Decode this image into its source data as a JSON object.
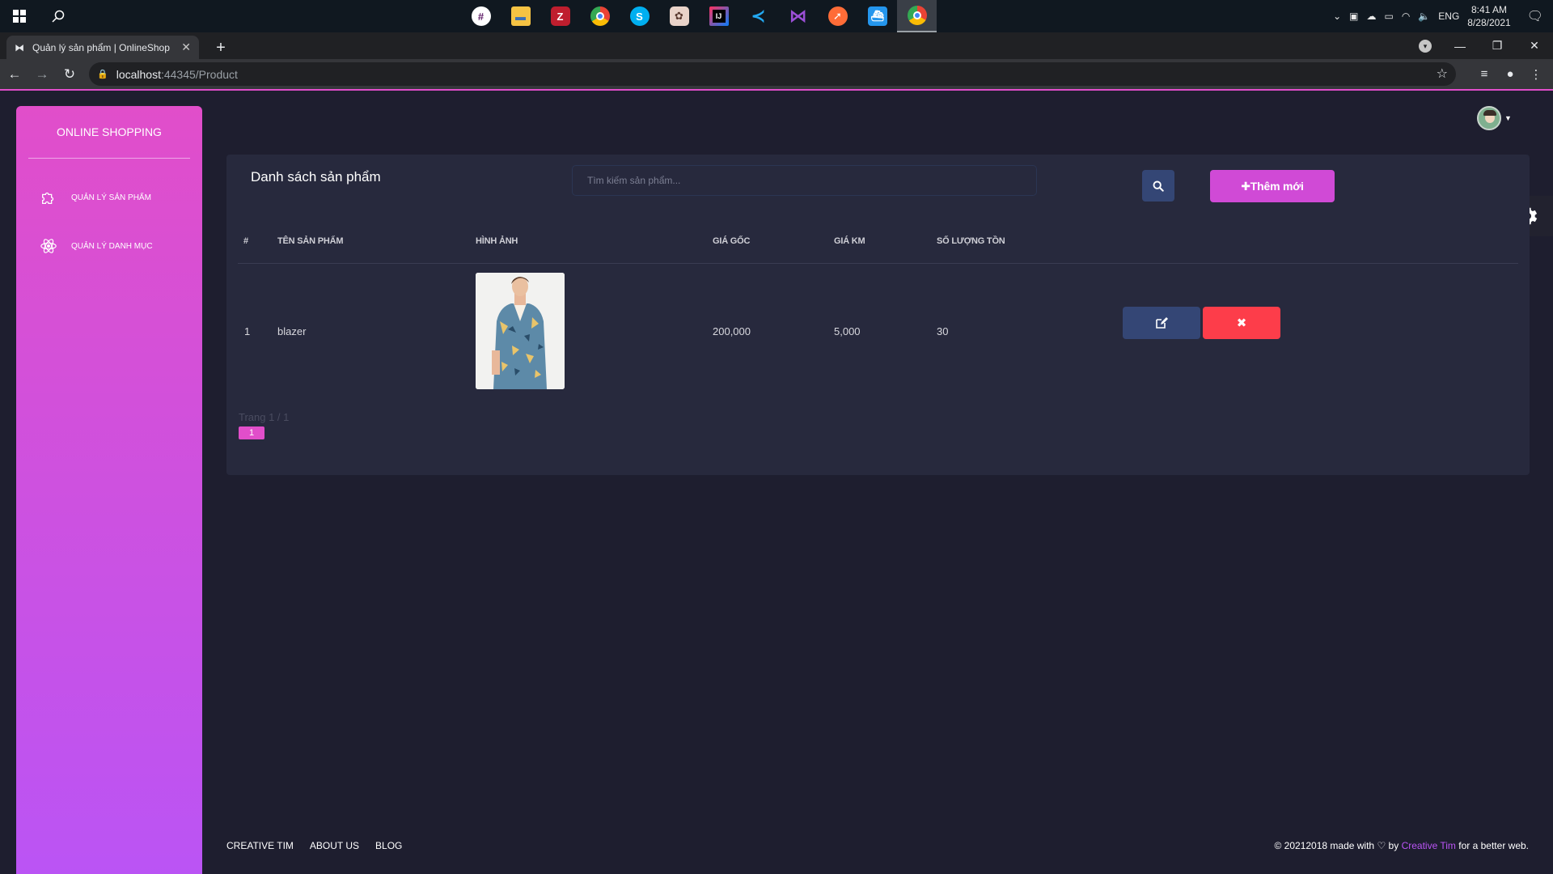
{
  "taskbar": {
    "apps": [
      "slack-icon",
      "file-explorer-icon",
      "filezilla-icon",
      "chrome-icon",
      "skype-icon",
      "anime-app-icon",
      "intellij-icon",
      "vscode-icon",
      "visual-studio-icon",
      "postman-icon",
      "docker-icon",
      "chrome-active-icon"
    ],
    "tray_lang": "ENG",
    "time": "8:41 AM",
    "date": "8/28/2021"
  },
  "browser": {
    "tab_title": "Quản lý sản phẩm | OnlineShop",
    "url_host": "localhost",
    "url_path": ":44345/Product"
  },
  "sidebar": {
    "brand": "ONLINE SHOPPING",
    "items": [
      {
        "label": "QUẢN LÝ SẢN PHẨM",
        "icon": "puzzle-icon"
      },
      {
        "label": "QUẢN LÝ DANH MỤC",
        "icon": "atom-icon"
      }
    ]
  },
  "card": {
    "title": "Danh sách sản phẩm",
    "search_placeholder": "Tìm kiếm sản phẩm...",
    "add_label": "✚Thêm mới"
  },
  "table": {
    "headers": [
      "#",
      "TÊN SẢN PHẨM",
      "HÌNH ẢNH",
      "GIÁ GỐC",
      "GIÁ KM",
      "SỐ LƯỢNG TỒN"
    ],
    "rows": [
      {
        "index": "1",
        "name": "blazer",
        "price": "200,000",
        "sale_price": "5,000",
        "stock": "30"
      }
    ]
  },
  "pager": {
    "text": "Trang 1 / 1",
    "current": "1"
  },
  "footer": {
    "links": [
      "CREATIVE TIM",
      "ABOUT US",
      "BLOG"
    ],
    "copy_pre": "© 20212018 made with",
    "copy_by": "by",
    "copy_brand": "Creative Tim",
    "copy_post": "for a better web."
  },
  "colors": {
    "accent": "#e14eca",
    "accent2": "#ba54f5",
    "card_bg": "#27293d",
    "page_bg": "#1e1e2f",
    "edit_btn": "#344675",
    "delete_btn": "#fd3d4a"
  }
}
